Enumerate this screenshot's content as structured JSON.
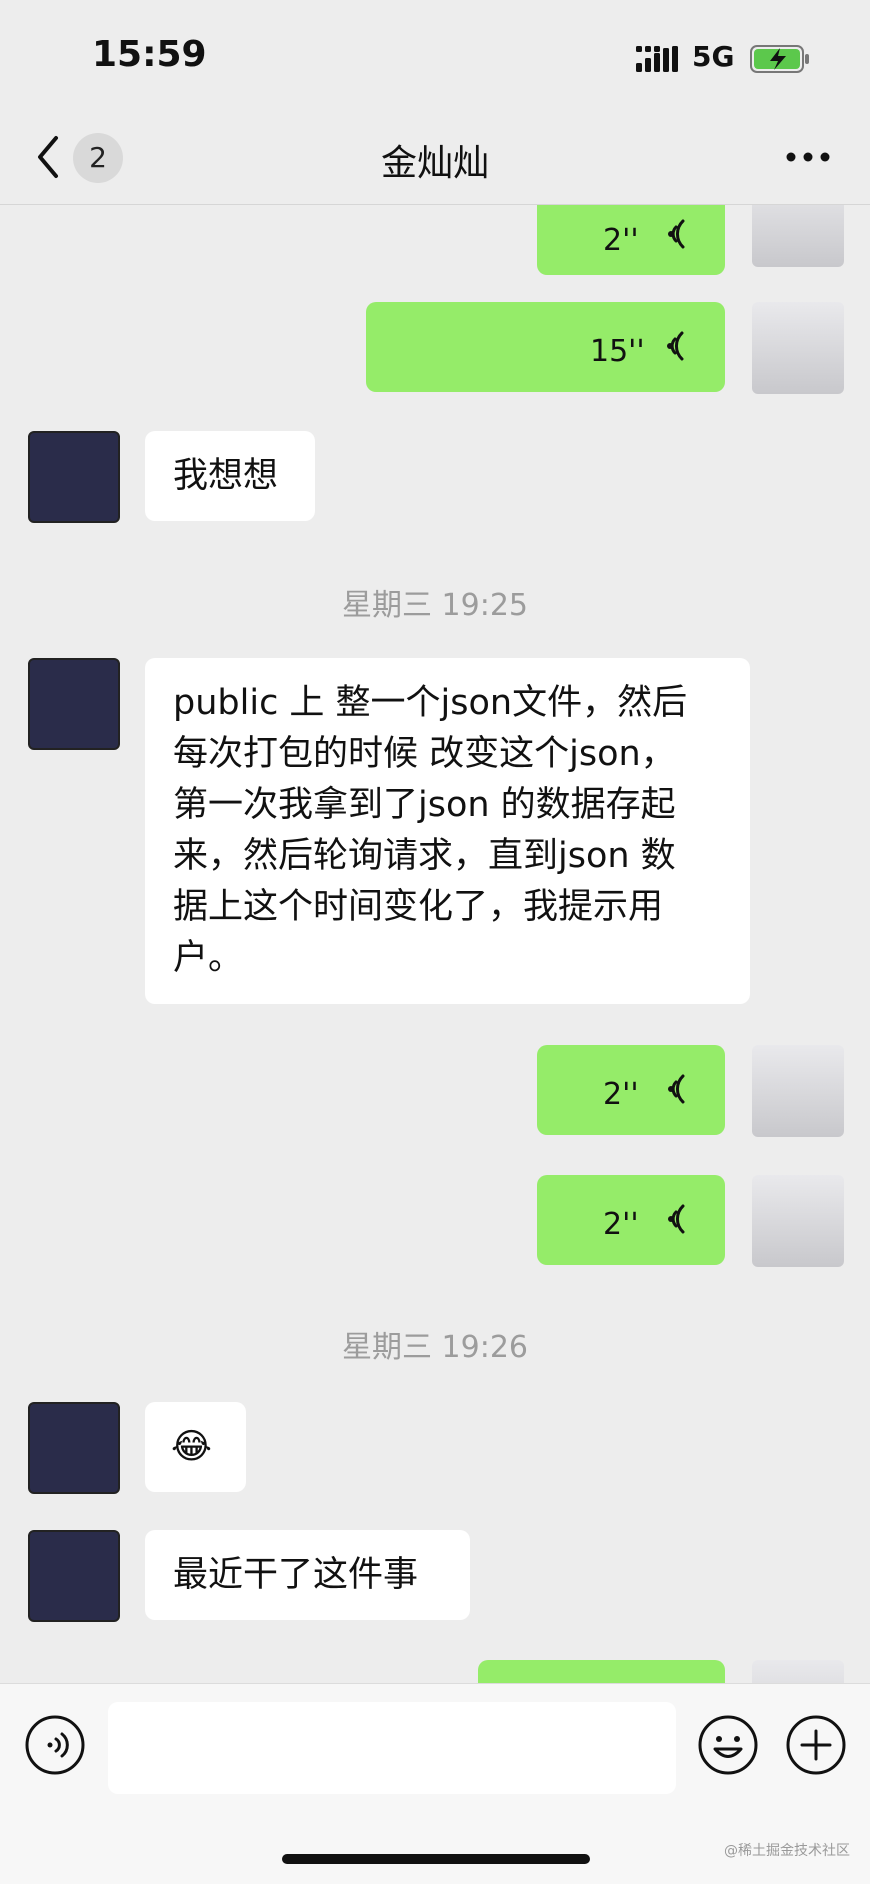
{
  "status_bar": {
    "time": "15:59",
    "network": "5G"
  },
  "nav": {
    "unread": "2",
    "title": "金灿灿"
  },
  "messages": {
    "m1": {
      "duration": "2''"
    },
    "m2": {
      "duration": "15''"
    },
    "m3": {
      "text": "我想想"
    },
    "sep1": "星期三 19:25",
    "m4": {
      "lines": [
        "public 上 整一个json文件，然后",
        "每次打包的时候 改变这个json，",
        "第一次我拿到了json 的数据存起",
        "来，然后轮询请求，直到json 数",
        "据上这个时间变化了，我提示用",
        "户。"
      ]
    },
    "m5": {
      "duration": "2''"
    },
    "m6": {
      "duration": "2''"
    },
    "sep2": "星期三 19:26",
    "m7": {
      "emoji": "😂"
    },
    "m8": {
      "text": "最近干了这件事"
    }
  },
  "watermark": "@稀土掘金技术社区",
  "colors": {
    "bubble_green": "#95ec69",
    "bubble_white": "#ffffff",
    "background": "#ededed"
  },
  "icons": [
    "back-chevron-icon",
    "more-dots-icon",
    "voice-wave-icon",
    "emoji-icon",
    "plus-icon",
    "signal-icon",
    "battery-charging-icon"
  ]
}
